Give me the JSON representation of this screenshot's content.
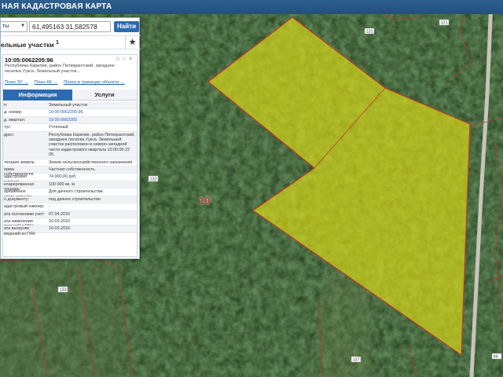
{
  "header": {
    "title": "НАЯ КАДАСТРОВАЯ КАРТА"
  },
  "search": {
    "type_label": "ты",
    "coords_value": "61,495163 31,582578",
    "find_button": "Найти"
  },
  "section": {
    "title": "ельные участки",
    "sup": "1"
  },
  "card": {
    "id": "10:05:0062205:96",
    "address": "Республика Карелия, район Питкярантский, западнее поселка Уукса. Земельный участок…",
    "links": [
      "План ЗУ →",
      "План КК →",
      "Поиск в границах объекта →"
    ],
    "tab_info": "Информация",
    "tab_services": "Услуги",
    "rows": [
      {
        "k": "п:",
        "v": "Земельный участок",
        "link": false
      },
      {
        "k": "д. номер:",
        "v": "10:05:0062205:96",
        "link": true
      },
      {
        "k": "д. квартал:",
        "v": "10:05:0062205",
        "link": true
      },
      {
        "k": "тус:",
        "v": "Учтенный",
        "link": false
      },
      {
        "k": "дрес:",
        "v": "Республика Карелия, район Питкярантский, западнее поселка Уукса. Земельный участок расположен в северо-западной части кадастрового квартала 10:05:06 22 05.",
        "link": false
      },
      {
        "k": "тегория земель:",
        "v": "Земли сельскохозяйственного назначения",
        "link": false
      },
      {
        "k": "орма собственности:",
        "v": "Частная собственность",
        "link": false
      },
      {
        "k": "адастровая оимость:",
        "v": "74 000,00 руб.",
        "link": false
      },
      {
        "k": "кларированная лощадь:",
        "v": "100 000 кв. м",
        "link": false
      },
      {
        "k": "зрешенное спользование:",
        "v": "Для дачного строительства",
        "link": false
      },
      {
        "k": "о документу:",
        "v": "под дачное строительство",
        "link": false
      },
      {
        "k": "адастровый нженер:",
        "v": "-",
        "link": false
      },
      {
        "k": "ата постановки учет:",
        "v": "07.04.2010",
        "link": false
      },
      {
        "k": "ата изменения ведений в ГКН:",
        "v": "10.03.2016",
        "link": false
      },
      {
        "k": "ата выгрузки ведений из ГКН:",
        "v": "10.03.2016",
        "link": false
      }
    ]
  },
  "map": {
    "big_label": "10",
    "labels": [
      "131",
      "121",
      "132",
      "133",
      "137",
      "94"
    ]
  },
  "colors": {
    "accent": "#2d6bb0",
    "parcel_fill": "#e6e414",
    "parcel_border": "#c0392b"
  }
}
